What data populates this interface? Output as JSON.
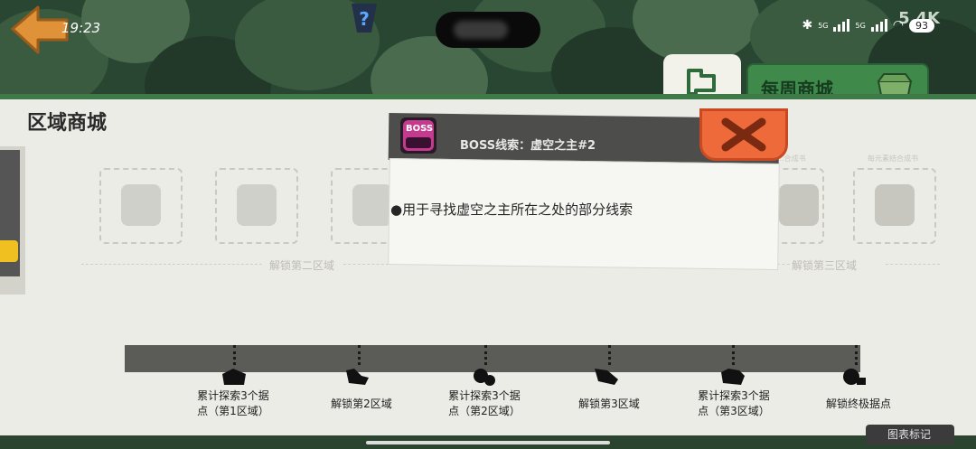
{
  "status_bar": {
    "time": "19:23",
    "network_left": "5G",
    "network_right": "5G",
    "battery": "93",
    "gem_count": "5.4K"
  },
  "tabs": {
    "map_icon": "map-flag-icon",
    "weekly_shop_label": "每周商城"
  },
  "panel": {
    "title": "区域商城"
  },
  "slots": {
    "zone2_labels": [
      "",
      "",
      ""
    ],
    "zone3_labels": [
      "...合成书",
      "每元素结合成书"
    ],
    "unlock_zone2": "解锁第二区域",
    "unlock_zone3": "解锁第三区域"
  },
  "tooltip": {
    "icon_text": "BOSS",
    "title": "BOSS线索：虚空之主#2",
    "description": "●用于寻找虚空之主所在之处的部分线索"
  },
  "milestones": [
    {
      "label_1": "累计探索3个据",
      "label_2": "点（第1区域）"
    },
    {
      "label_1": "解锁第2区域",
      "label_2": ""
    },
    {
      "label_1": "累计探索3个据",
      "label_2": "点（第2区域）"
    },
    {
      "label_1": "解锁第3区域",
      "label_2": ""
    },
    {
      "label_1": "累计探索3个据",
      "label_2": "点（第3区域）"
    },
    {
      "label_1": "解锁终极据点",
      "label_2": ""
    }
  ],
  "corner_button": "图表标记",
  "colors": {
    "accent_green": "#3f8a4b",
    "close_orange": "#ef6a3a",
    "panel_bg": "#ecece6",
    "track_dark": "#5b5b58"
  }
}
